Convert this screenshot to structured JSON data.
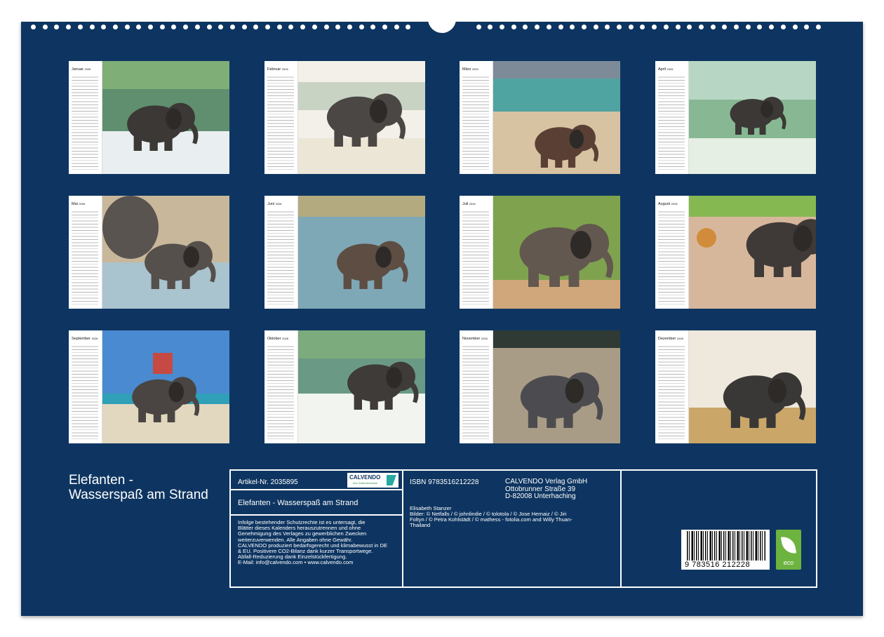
{
  "months": [
    {
      "name": "Januar",
      "year": "2026",
      "scene": "wave"
    },
    {
      "name": "Februar",
      "year": "2026",
      "scene": "splash"
    },
    {
      "name": "März",
      "year": "2026",
      "scene": "beach-roll"
    },
    {
      "name": "April",
      "year": "2026",
      "scene": "swim"
    },
    {
      "name": "Mai",
      "year": "2026",
      "scene": "mother-calf"
    },
    {
      "name": "Juni",
      "year": "2026",
      "scene": "river"
    },
    {
      "name": "Juli",
      "year": "2026",
      "scene": "pond"
    },
    {
      "name": "August",
      "year": "2026",
      "scene": "hat"
    },
    {
      "name": "September",
      "year": "2026",
      "scene": "saddle-beach"
    },
    {
      "name": "Oktober",
      "year": "2026",
      "scene": "surf"
    },
    {
      "name": "November",
      "year": "2026",
      "scene": "walk"
    },
    {
      "name": "Dezember",
      "year": "2026",
      "scene": "sand-rest"
    }
  ],
  "title": {
    "line1": "Elefanten -",
    "line2": "Wasserspaß am Strand"
  },
  "info": {
    "article": "Artikel-Nr. 2035895",
    "subtitle": "Elefanten - Wasserspaß am Strand",
    "legal": [
      "Infolge bestehender Schutzrechte ist es untersagt, die",
      "Blätter dieses Kalenders herauszutrennen und ohne",
      "Genehmigung des Verlages zu gewerblichen Zwecken",
      "weiterzuverwenden. Alle Angaben ohne Gewähr.",
      "CALVENDO produziert bedarfsgerecht und klimabewusst in DE",
      "& EU. Positivere CO2-Bilanz dank kurzer Transportwege.",
      "Abfall-Reduzierung dank Einzelstückfertigung.",
      "E-Mail: info@calvendo.com • www.calvendo.com"
    ],
    "isbn": "ISBN 9783516212228",
    "publisher": [
      "CALVENDO Verlag GmbH",
      "Ottobrunner Straße 39",
      "D-82008 Unterhaching"
    ],
    "author": "Elisabeth Stanzer",
    "credits": [
      "Bilder: © Netfalls / © johnlindie / © tolotola / © Jose Hernaiz / © Jiri",
      "Foltyn / © Petra Kohlstädt / © mathess - fotolia.com and Willy Thuan-",
      "Thailand"
    ],
    "logo_text": "CALVENDO",
    "logo_sub": "Ihre Kalendermarke",
    "barcode_number": "9 783516 212228",
    "eco_label": "eco"
  },
  "colors": {
    "board": "#0e3561",
    "eco": "#6cb33f"
  }
}
